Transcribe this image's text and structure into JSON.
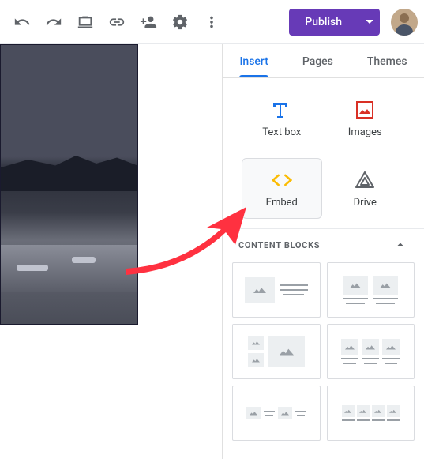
{
  "toolbar": {
    "publish_label": "Publish"
  },
  "sidebar": {
    "tabs": {
      "insert": "Insert",
      "pages": "Pages",
      "themes": "Themes"
    },
    "insert": {
      "textbox": "Text box",
      "images": "Images",
      "embed": "Embed",
      "drive": "Drive"
    },
    "section": {
      "content_blocks": "CONTENT BLOCKS"
    }
  }
}
